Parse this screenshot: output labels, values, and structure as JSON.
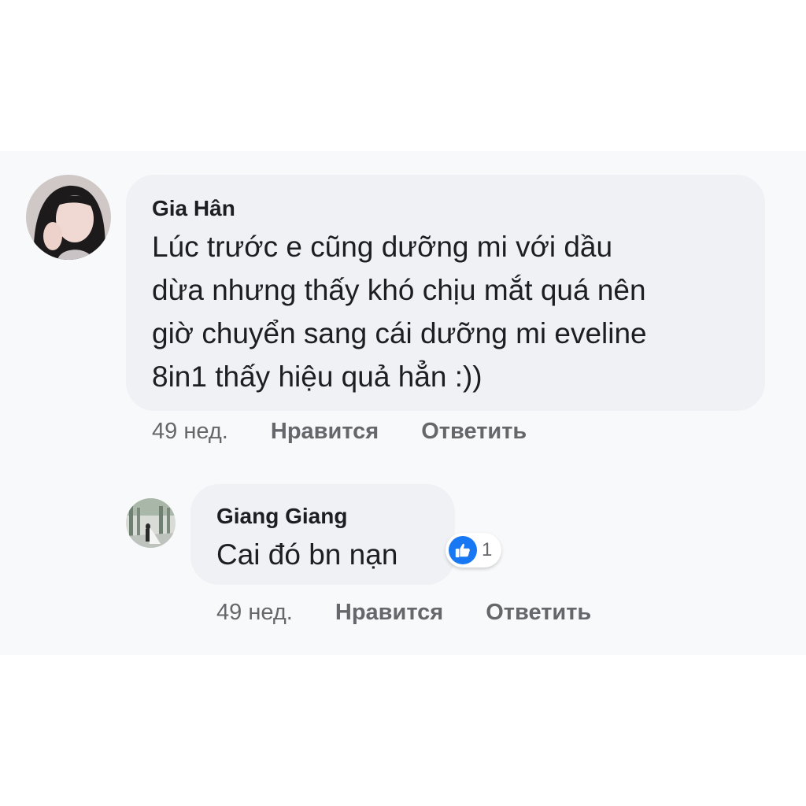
{
  "comments": [
    {
      "author": "Gia Hân",
      "text": "Lúc trước e cũng dưỡng mi với dầu\ndừa nhưng thấy khó chịu mắt quá nên\ngiờ chuyển sang cái dưỡng mi eveline\n8in1 thấy hiệu quả hẳn :))",
      "time": "49 нед.",
      "like_label": "Нравится",
      "reply_label": "Ответить"
    },
    {
      "author": "Giang Giang",
      "text": "Cai đó bn nạn",
      "time": "49 нед.",
      "like_label": "Нравится",
      "reply_label": "Ответить",
      "reaction": {
        "icon": "thumbs-up-icon",
        "count": "1",
        "color": "#1877f2"
      }
    }
  ],
  "colors": {
    "bubble": "#eff1f4",
    "text": "#1c1e21",
    "meta": "#65676b",
    "thread_background": "#f8f9fb"
  }
}
